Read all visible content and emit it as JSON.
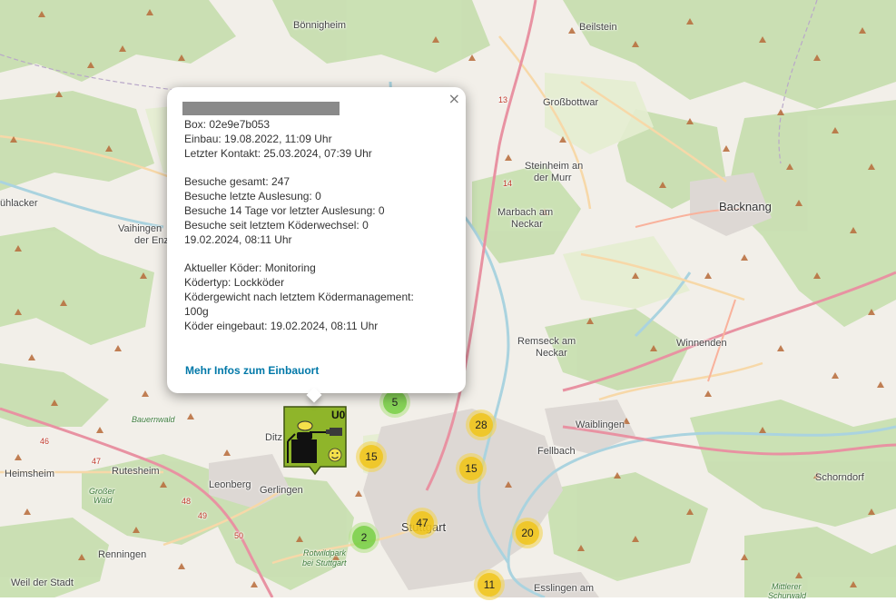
{
  "map": {
    "places": [
      {
        "name": "Bönnigheim",
        "cls": ""
      },
      {
        "name": "Beilstein",
        "cls": ""
      },
      {
        "name": "Großbottwar",
        "cls": ""
      },
      {
        "name": "Steinheim an",
        "cls": ""
      },
      {
        "name": "der Murr",
        "cls": ""
      },
      {
        "name": "Marbach am",
        "cls": ""
      },
      {
        "name": "Neckar",
        "cls": ""
      },
      {
        "name": "Backnang",
        "cls": "big"
      },
      {
        "name": "ühlacker",
        "cls": ""
      },
      {
        "name": "Vaihingen",
        "cls": ""
      },
      {
        "name": "der Enz",
        "cls": ""
      },
      {
        "name": "Remseck am",
        "cls": ""
      },
      {
        "name": "Neckar",
        "cls": ""
      },
      {
        "name": "Winnenden",
        "cls": ""
      },
      {
        "name": "Bauernwald",
        "cls": "green"
      },
      {
        "name": "Waiblingen",
        "cls": ""
      },
      {
        "name": "Fellbach",
        "cls": ""
      },
      {
        "name": "Ditz",
        "cls": ""
      },
      {
        "name": "Heimsheim",
        "cls": ""
      },
      {
        "name": "Rutesheim",
        "cls": ""
      },
      {
        "name": "Großer",
        "cls": "green"
      },
      {
        "name": "Wald",
        "cls": "green"
      },
      {
        "name": "Leonberg",
        "cls": ""
      },
      {
        "name": "Gerlingen",
        "cls": ""
      },
      {
        "name": "Stuttgart",
        "cls": "big"
      },
      {
        "name": "Schorndorf",
        "cls": ""
      },
      {
        "name": "Renningen",
        "cls": ""
      },
      {
        "name": "Rotwildpark",
        "cls": "green"
      },
      {
        "name": "bei Stuttgart",
        "cls": "green"
      },
      {
        "name": "Weil der Stadt",
        "cls": ""
      },
      {
        "name": "Esslingen am",
        "cls": ""
      },
      {
        "name": "Mittlerer",
        "cls": "green"
      },
      {
        "name": "Schurwald",
        "cls": "green"
      },
      {
        "name": "46",
        "cls": "road"
      },
      {
        "name": "47",
        "cls": "road"
      },
      {
        "name": "48",
        "cls": "road"
      },
      {
        "name": "49",
        "cls": "road"
      },
      {
        "name": "50",
        "cls": "road"
      },
      {
        "name": "13",
        "cls": "road"
      },
      {
        "name": "14",
        "cls": "road"
      }
    ],
    "clusters": [
      {
        "count": "5",
        "color": "green"
      },
      {
        "count": "28",
        "color": "yellow"
      },
      {
        "count": "15",
        "color": "yellow"
      },
      {
        "count": "15",
        "color": "yellow"
      },
      {
        "count": "47",
        "color": "yellow"
      },
      {
        "count": "20",
        "color": "yellow"
      },
      {
        "count": "2",
        "color": "green"
      },
      {
        "count": "11",
        "color": "yellow"
      }
    ]
  },
  "marker": {
    "label": "U0",
    "status": "smiley-face",
    "bait_color": "#f5e04a",
    "background": "#8fb52a"
  },
  "popup": {
    "close": "×",
    "lines": {
      "box": "Box: 02e9e7b053",
      "einbau": "Einbau: 19.08.2022, 11:09 Uhr",
      "kontakt": "Letzter Kontakt: 25.03.2024, 07:39 Uhr",
      "besuche_gesamt": "Besuche gesamt: 247",
      "besuche_letzte": "Besuche letzte Auslesung: 0",
      "besuche_14": "Besuche 14 Tage vor letzter Auslesung: 0",
      "besuche_koeder": "Besuche seit letztem Köderwechsel: 0",
      "besuche_datum": "19.02.2024, 08:11 Uhr",
      "koeder": "Aktueller Köder: Monitoring",
      "koedertyp": "Ködertyp: Lockköder",
      "koedergewicht_1": "Ködergewicht nach letztem Ködermanagement:",
      "koedergewicht_2": "100g",
      "koeder_eingebaut": "Köder eingebaut: 19.02.2024, 08:11 Uhr"
    },
    "link": "Mehr Infos zum Einbauort"
  }
}
